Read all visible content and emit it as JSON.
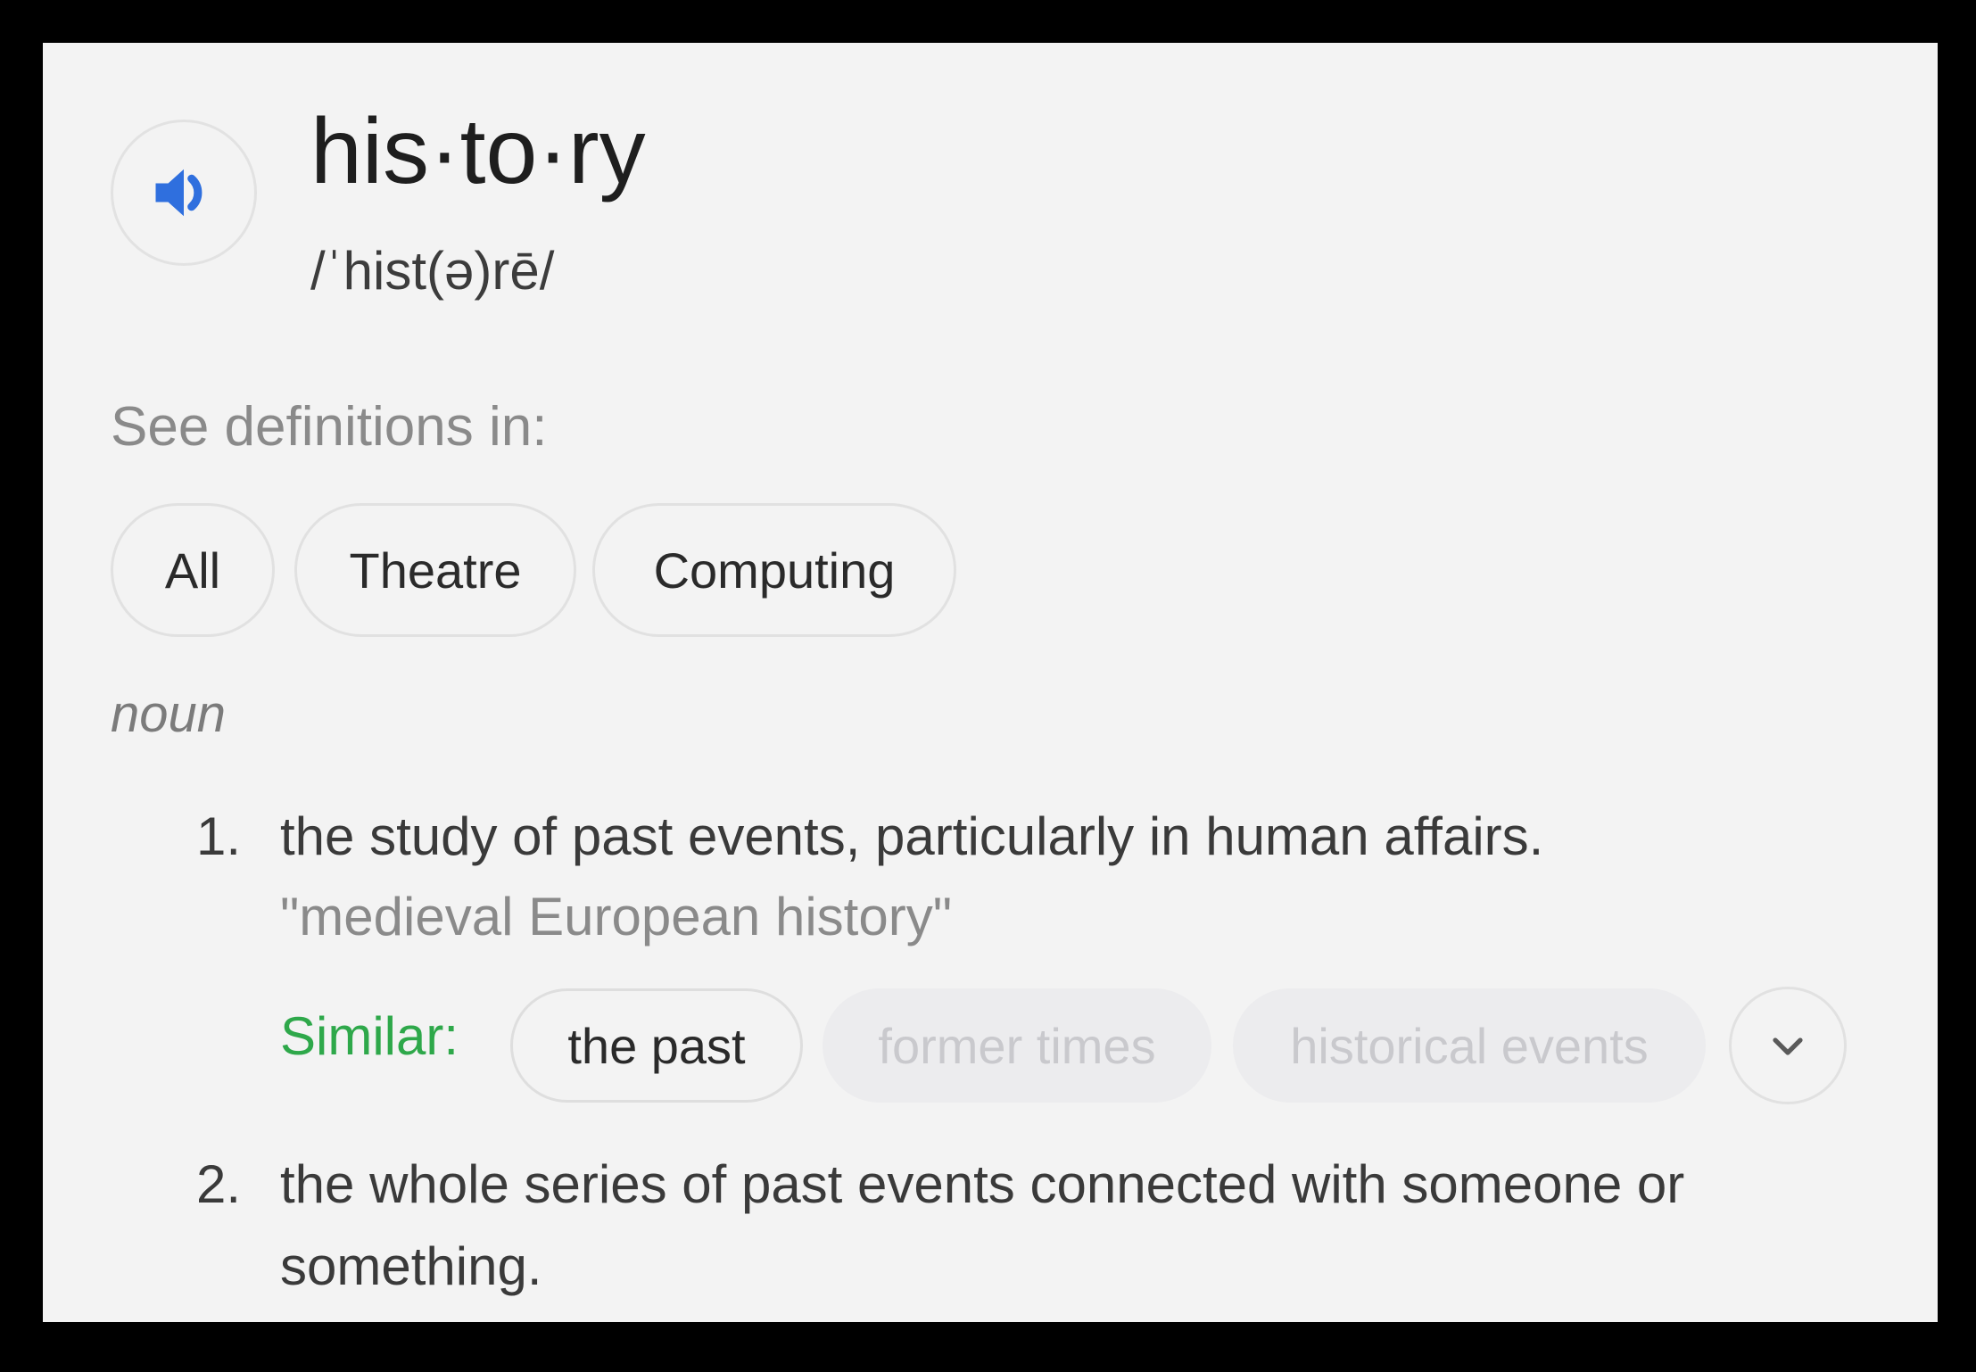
{
  "entry": {
    "headword": "his·to·ry",
    "pronunciation": "/ˈhist(ə)rē/",
    "audio_icon": "speaker-icon"
  },
  "see_definitions": {
    "label": "See definitions in:",
    "chips": [
      "All",
      "Theatre",
      "Computing"
    ]
  },
  "part_of_speech": "noun",
  "definitions": [
    {
      "number": "1.",
      "text": "the study of past events, particularly in human affairs.",
      "example": "\"medieval European history\"",
      "similar_label": "Similar:",
      "similar": [
        "the past",
        "former times",
        "historical events"
      ],
      "expand_icon": "chevron-down-icon"
    },
    {
      "number": "2.",
      "text": "the whole series of past events connected with someone or something."
    }
  ],
  "colors": {
    "accent_blue": "#2f6fde",
    "similar_green": "#2ea84a",
    "background": "#f3f3f3"
  }
}
